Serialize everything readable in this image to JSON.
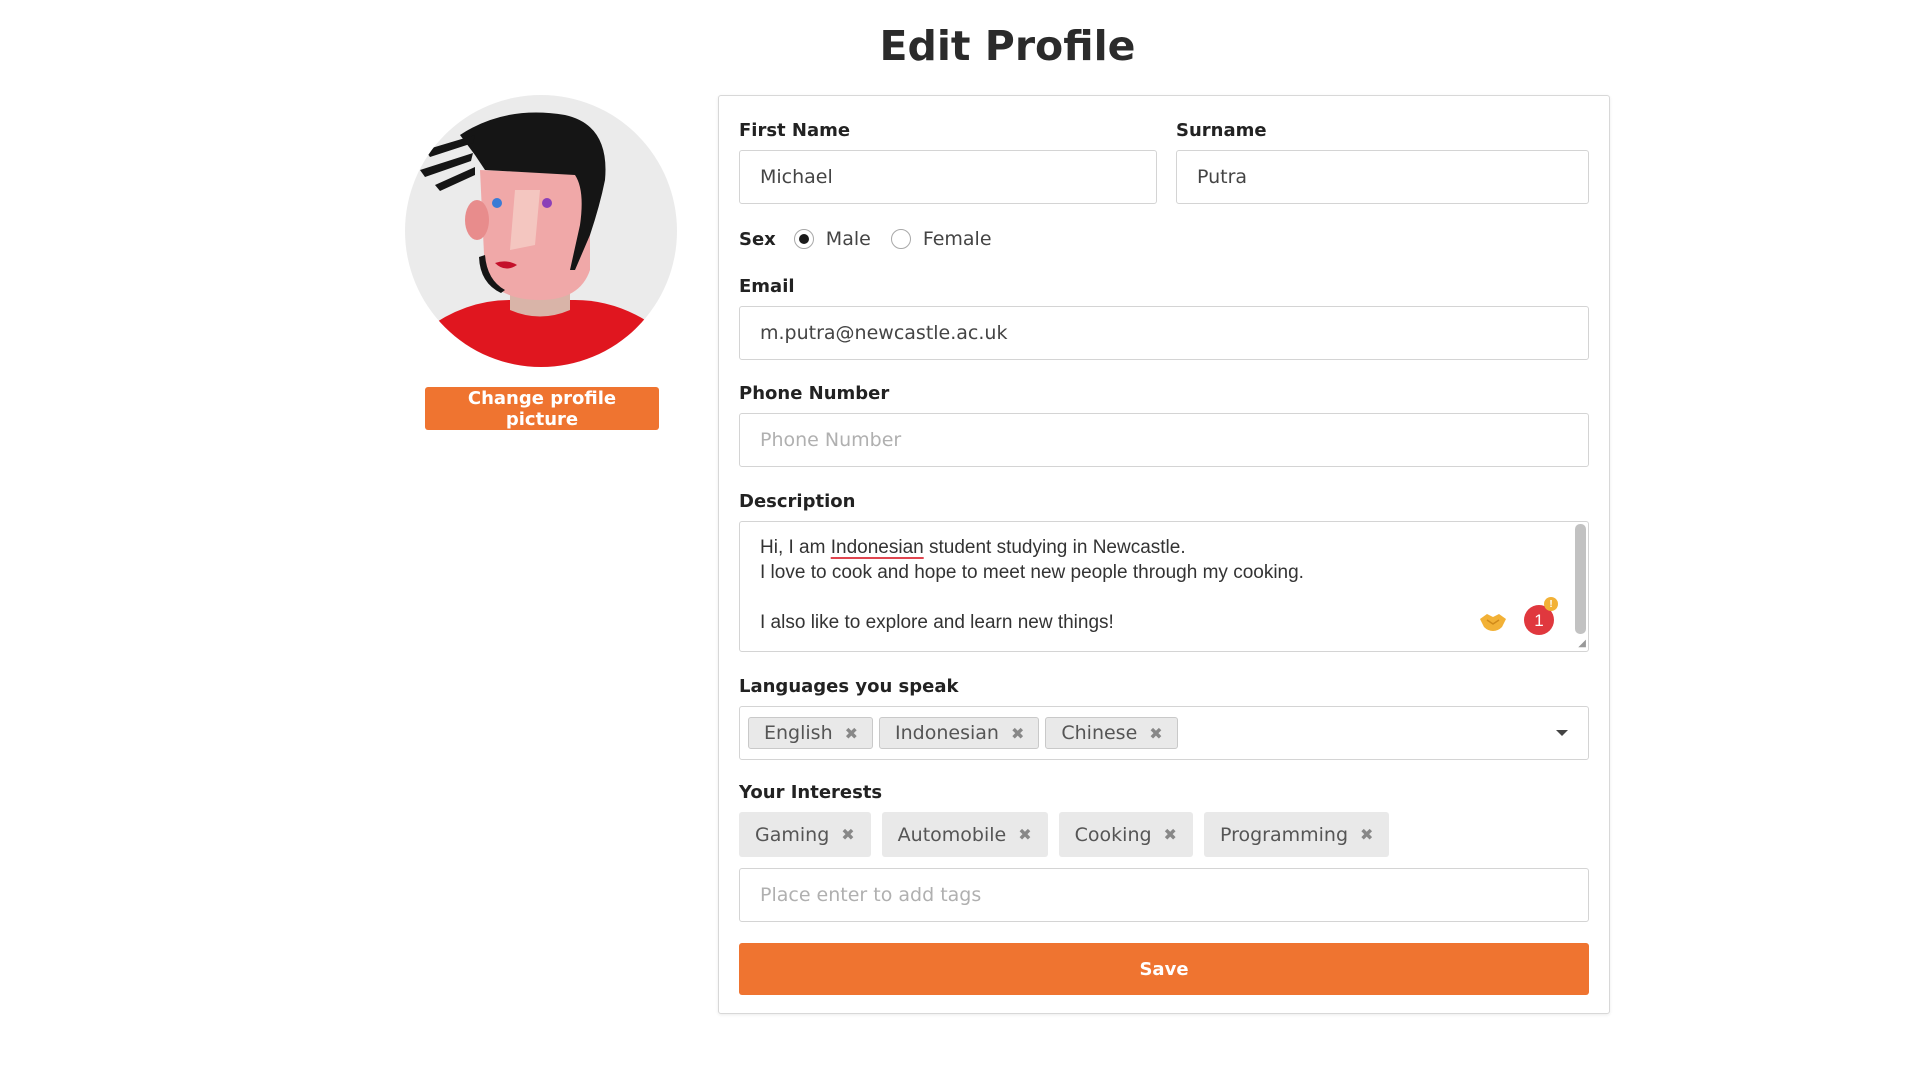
{
  "page": {
    "title": "Edit Profile"
  },
  "profile_picture": {
    "change_label": "Change profile picture"
  },
  "form": {
    "first_name": {
      "label": "First Name",
      "value": "Michael"
    },
    "surname": {
      "label": "Surname",
      "value": "Putra"
    },
    "sex": {
      "label": "Sex",
      "options": [
        {
          "label": "Male",
          "selected": true
        },
        {
          "label": "Female",
          "selected": false
        }
      ]
    },
    "email": {
      "label": "Email",
      "value": "m.putra@newcastle.ac.uk"
    },
    "phone": {
      "label": "Phone Number",
      "value": "",
      "placeholder": "Phone Number"
    },
    "description": {
      "label": "Description",
      "line1_pre": "Hi, I am ",
      "line1_misspelled": "Indonesian",
      "line1_post": " student studying in Newcastle.",
      "line2": "I love to cook and hope to meet new people through my cooking.",
      "line3": "",
      "line4": "I also like to explore and learn new things!",
      "notification_count": "1",
      "notification_alert": "!"
    },
    "languages": {
      "label": "Languages you speak",
      "items": [
        "English",
        "Indonesian",
        "Chinese"
      ]
    },
    "interests": {
      "label": "Your Interests",
      "items": [
        "Gaming",
        "Automobile",
        "Cooking",
        "Programming"
      ],
      "placeholder": "Place enter to add tags"
    },
    "save_label": "Save",
    "remove_glyph": "✖"
  },
  "colors": {
    "accent": "#ef7430",
    "badge": "#e0383e"
  }
}
